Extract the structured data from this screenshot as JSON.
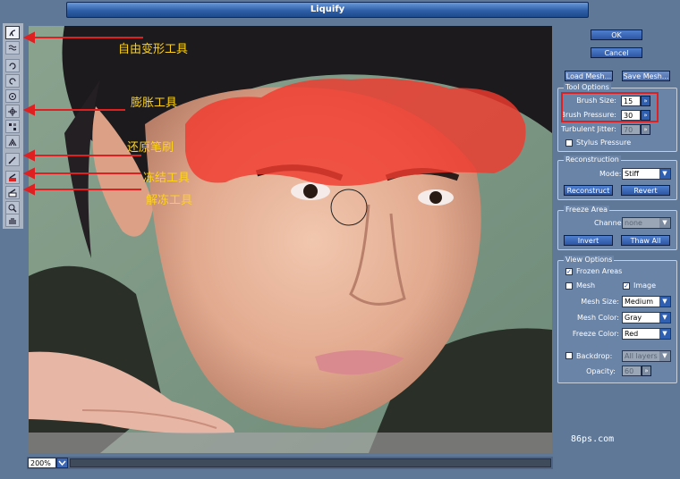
{
  "window": {
    "title": "Liquify"
  },
  "tools": [
    {
      "name": "warp-tool"
    },
    {
      "name": "turbulence-tool"
    },
    {
      "name": "twirl-cw-tool"
    },
    {
      "name": "twirl-ccw-tool"
    },
    {
      "name": "pucker-tool"
    },
    {
      "name": "bloat-tool"
    },
    {
      "name": "shift-pixels-tool"
    },
    {
      "name": "reflection-tool"
    },
    {
      "name": "reconstruct-tool"
    },
    {
      "name": "freeze-tool"
    },
    {
      "name": "thaw-tool"
    },
    {
      "name": "zoom-tool"
    },
    {
      "name": "hand-tool"
    }
  ],
  "annotations": {
    "warp": "自由变形工具",
    "bloat": "膨胀工具",
    "reconstruct": "还原笔刷",
    "freeze": "冻结工具",
    "thaw": "解冻工具"
  },
  "buttons": {
    "ok": "OK",
    "cancel": "Cancel",
    "load_mesh": "Load Mesh...",
    "save_mesh": "Save Mesh..."
  },
  "tool_options": {
    "title": "Tool Options",
    "brush_size_label": "Brush Size:",
    "brush_size": "15",
    "brush_pressure_label": "Brush Pressure:",
    "brush_pressure": "30",
    "turbulent_jitter_label": "Turbulent Jitter:",
    "turbulent_jitter": "70",
    "stylus_pressure_label": "Stylus Pressure"
  },
  "reconstruction": {
    "title": "Reconstruction",
    "mode_label": "Mode:",
    "mode": "Stiff",
    "reconstruct_button": "Reconstruct",
    "revert_button": "Revert"
  },
  "freeze_area": {
    "title": "Freeze Area",
    "channel_label": "Channel:",
    "channel": "none",
    "invert_button": "Invert",
    "thaw_all_button": "Thaw All"
  },
  "view_options": {
    "title": "View Options",
    "frozen_areas_label": "Frozen Areas",
    "frozen_areas_checked": true,
    "mesh_label": "Mesh",
    "mesh_checked": false,
    "image_label": "Image",
    "image_checked": true,
    "mesh_size_label": "Mesh Size:",
    "mesh_size": "Medium",
    "mesh_color_label": "Mesh Color:",
    "mesh_color": "Gray",
    "freeze_color_label": "Freeze Color:",
    "freeze_color": "Red",
    "backdrop_label": "Backdrop:",
    "backdrop_checked": false,
    "backdrop": "All layers",
    "opacity_label": "Opacity:",
    "opacity": "60"
  },
  "status": {
    "zoom": "200%"
  },
  "watermark": "86ps.com",
  "colors": {
    "accent": "#2f5fb0",
    "freeze_overlay": "#f03a2e",
    "annotation": "#ffd31a",
    "highlight_box": "#e02020"
  }
}
